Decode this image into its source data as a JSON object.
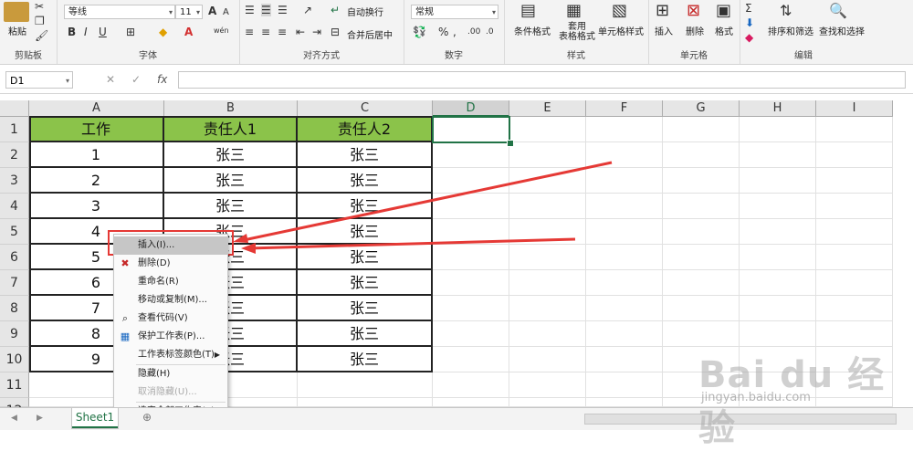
{
  "ribbon": {
    "clipboard": {
      "paste": "粘贴",
      "group": "剪贴板"
    },
    "font": {
      "name": "等线",
      "size": "11",
      "bold": "B",
      "italic": "I",
      "underline": "U",
      "wen": "wén",
      "group": "字体",
      "grow": "A",
      "shrink": "A"
    },
    "align": {
      "wrap": "自动换行",
      "merge": "合并后居中",
      "group": "对齐方式"
    },
    "number": {
      "format": "常规",
      "percent": "%",
      "comma": ",",
      "group": "数字"
    },
    "styles": {
      "cond": "条件格式",
      "table_line1": "套用",
      "table_line2": "表格格式",
      "cell": "单元格样式",
      "group": "样式"
    },
    "cells": {
      "insert": "插入",
      "delete": "删除",
      "format": "格式",
      "group": "单元格"
    },
    "editing": {
      "sort": "排序和筛选",
      "find": "查找和选择",
      "group": "编辑"
    }
  },
  "formula_bar": {
    "name_box": "D1",
    "cancel": "✕",
    "enter": "✓",
    "fx": "fx"
  },
  "columns": [
    "A",
    "B",
    "C",
    "D",
    "E",
    "F",
    "G",
    "H",
    "I"
  ],
  "rows": [
    "1",
    "2",
    "3",
    "4",
    "5",
    "6",
    "7",
    "8",
    "9",
    "10",
    "11",
    "12"
  ],
  "table": {
    "headers": [
      "工作",
      "责任人1",
      "责任人2"
    ],
    "rows": [
      [
        "1",
        "张三",
        "张三"
      ],
      [
        "2",
        "张三",
        "张三"
      ],
      [
        "3",
        "张三",
        "张三"
      ],
      [
        "4",
        "张三",
        "张三"
      ],
      [
        "5",
        "张三",
        "张三"
      ],
      [
        "6",
        "张三",
        "张三"
      ],
      [
        "7",
        "张三",
        "张三"
      ],
      [
        "8",
        "张三",
        "张三"
      ],
      [
        "9",
        "张三",
        "张三"
      ]
    ],
    "header_color": "#8bc34a"
  },
  "selected_cell": "D1",
  "context_menu": [
    {
      "label": "插入(I)...",
      "icon": "",
      "highlight": true
    },
    {
      "label": "删除(D)",
      "icon": "delete-sheet-icon"
    },
    {
      "label": "重命名(R)",
      "icon": ""
    },
    {
      "label": "移动或复制(M)...",
      "icon": ""
    },
    {
      "label": "查看代码(V)",
      "icon": "view-code-icon"
    },
    {
      "label": "保护工作表(P)...",
      "icon": "protect-sheet-icon"
    },
    {
      "label": "工作表标签颜色(T)",
      "icon": "",
      "submenu": true
    },
    {
      "label": "隐藏(H)",
      "icon": ""
    },
    {
      "label": "取消隐藏(U)...",
      "icon": "",
      "disabled": true
    },
    {
      "label": "选定全部工作表(S)",
      "icon": ""
    }
  ],
  "sheet_tab": "Sheet1",
  "watermark": {
    "main": "Bai du 经验",
    "url": "jingyan.baidu.com"
  },
  "accent_color": "#217346",
  "arrow_color": "#e53935"
}
